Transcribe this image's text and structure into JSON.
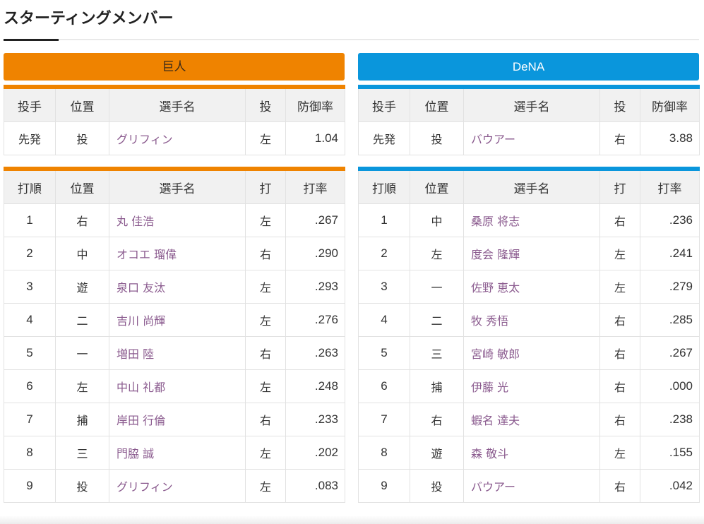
{
  "section_title": "スターティングメンバー",
  "colors": {
    "giants": "#ef8300",
    "dena": "#0a96dc",
    "player_link": "#8a5a8e"
  },
  "teams": [
    {
      "name": "巨人",
      "pitcher_headers": [
        "投手",
        "位置",
        "選手名",
        "投",
        "防御率"
      ],
      "pitcher": {
        "role": "先発",
        "position": "投",
        "name": "グリフィン",
        "hand": "左",
        "era": "1.04"
      },
      "batter_headers": [
        "打順",
        "位置",
        "選手名",
        "打",
        "打率"
      ],
      "batters": [
        {
          "order": "1",
          "position": "右",
          "name": "丸 佳浩",
          "hand": "左",
          "avg": ".267"
        },
        {
          "order": "2",
          "position": "中",
          "name": "オコエ 瑠偉",
          "hand": "右",
          "avg": ".290"
        },
        {
          "order": "3",
          "position": "遊",
          "name": "泉口 友汰",
          "hand": "左",
          "avg": ".293"
        },
        {
          "order": "4",
          "position": "二",
          "name": "吉川 尚輝",
          "hand": "左",
          "avg": ".276"
        },
        {
          "order": "5",
          "position": "一",
          "name": "増田 陸",
          "hand": "右",
          "avg": ".263"
        },
        {
          "order": "6",
          "position": "左",
          "name": "中山 礼都",
          "hand": "左",
          "avg": ".248"
        },
        {
          "order": "7",
          "position": "捕",
          "name": "岸田 行倫",
          "hand": "右",
          "avg": ".233"
        },
        {
          "order": "8",
          "position": "三",
          "name": "門脇 誠",
          "hand": "左",
          "avg": ".202"
        },
        {
          "order": "9",
          "position": "投",
          "name": "グリフィン",
          "hand": "左",
          "avg": ".083"
        }
      ]
    },
    {
      "name": "DeNA",
      "pitcher_headers": [
        "投手",
        "位置",
        "選手名",
        "投",
        "防御率"
      ],
      "pitcher": {
        "role": "先発",
        "position": "投",
        "name": "バウアー",
        "hand": "右",
        "era": "3.88"
      },
      "batter_headers": [
        "打順",
        "位置",
        "選手名",
        "打",
        "打率"
      ],
      "batters": [
        {
          "order": "1",
          "position": "中",
          "name": "桑原 将志",
          "hand": "右",
          "avg": ".236"
        },
        {
          "order": "2",
          "position": "左",
          "name": "度会 隆輝",
          "hand": "左",
          "avg": ".241"
        },
        {
          "order": "3",
          "position": "一",
          "name": "佐野 恵太",
          "hand": "左",
          "avg": ".279"
        },
        {
          "order": "4",
          "position": "二",
          "name": "牧 秀悟",
          "hand": "右",
          "avg": ".285"
        },
        {
          "order": "5",
          "position": "三",
          "name": "宮崎 敏郎",
          "hand": "右",
          "avg": ".267"
        },
        {
          "order": "6",
          "position": "捕",
          "name": "伊藤 光",
          "hand": "右",
          "avg": ".000"
        },
        {
          "order": "7",
          "position": "右",
          "name": "蝦名 達夫",
          "hand": "右",
          "avg": ".238"
        },
        {
          "order": "8",
          "position": "遊",
          "name": "森 敬斗",
          "hand": "左",
          "avg": ".155"
        },
        {
          "order": "9",
          "position": "投",
          "name": "バウアー",
          "hand": "右",
          "avg": ".042"
        }
      ]
    }
  ]
}
